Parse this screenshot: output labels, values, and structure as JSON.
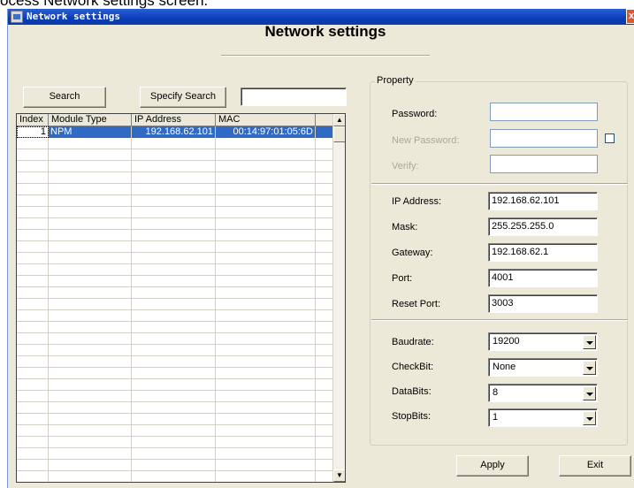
{
  "page_caption": "ocess Network settings screen.",
  "window": {
    "title": "Network settings",
    "close_glyph": "x"
  },
  "heading": "Network settings",
  "search": {
    "search_label": "Search",
    "specify_label": "Specify Search",
    "filter_value": ""
  },
  "table": {
    "columns": [
      "Index",
      "Module Type",
      "IP Address",
      "MAC"
    ],
    "rows": [
      {
        "index": "1",
        "module_type": "NPM",
        "ip": "192.168.62.101",
        "mac": "00:14:97:01:05:6D",
        "selected": true
      }
    ],
    "scroll_up": "▲",
    "scroll_down": "▼"
  },
  "property": {
    "legend": "Property",
    "password_label": "Password:",
    "password_value": "",
    "new_password_label": "New Password:",
    "new_password_value": "",
    "new_password_checked": false,
    "verify_label": "Verify:",
    "verify_value": "",
    "ip_label": "IP Address:",
    "ip_value": "192.168.62.101",
    "mask_label": "Mask:",
    "mask_value": "255.255.255.0",
    "gateway_label": "Gateway:",
    "gateway_value": "192.168.62.1",
    "port_label": "Port:",
    "port_value": "4001",
    "reset_port_label": "Reset Port:",
    "reset_port_value": "3003",
    "baudrate_label": "Baudrate:",
    "baudrate_value": "19200",
    "checkbit_label": "CheckBit:",
    "checkbit_value": "None",
    "databits_label": "DataBits:",
    "databits_value": "8",
    "stopbits_label": "StopBits:",
    "stopbits_value": "1"
  },
  "actions": {
    "apply_label": "Apply",
    "exit_label": "Exit"
  },
  "colors": {
    "selection": "#316ac5",
    "titlebar": "#0a3cb6",
    "window_bg": "#ece9d8"
  }
}
